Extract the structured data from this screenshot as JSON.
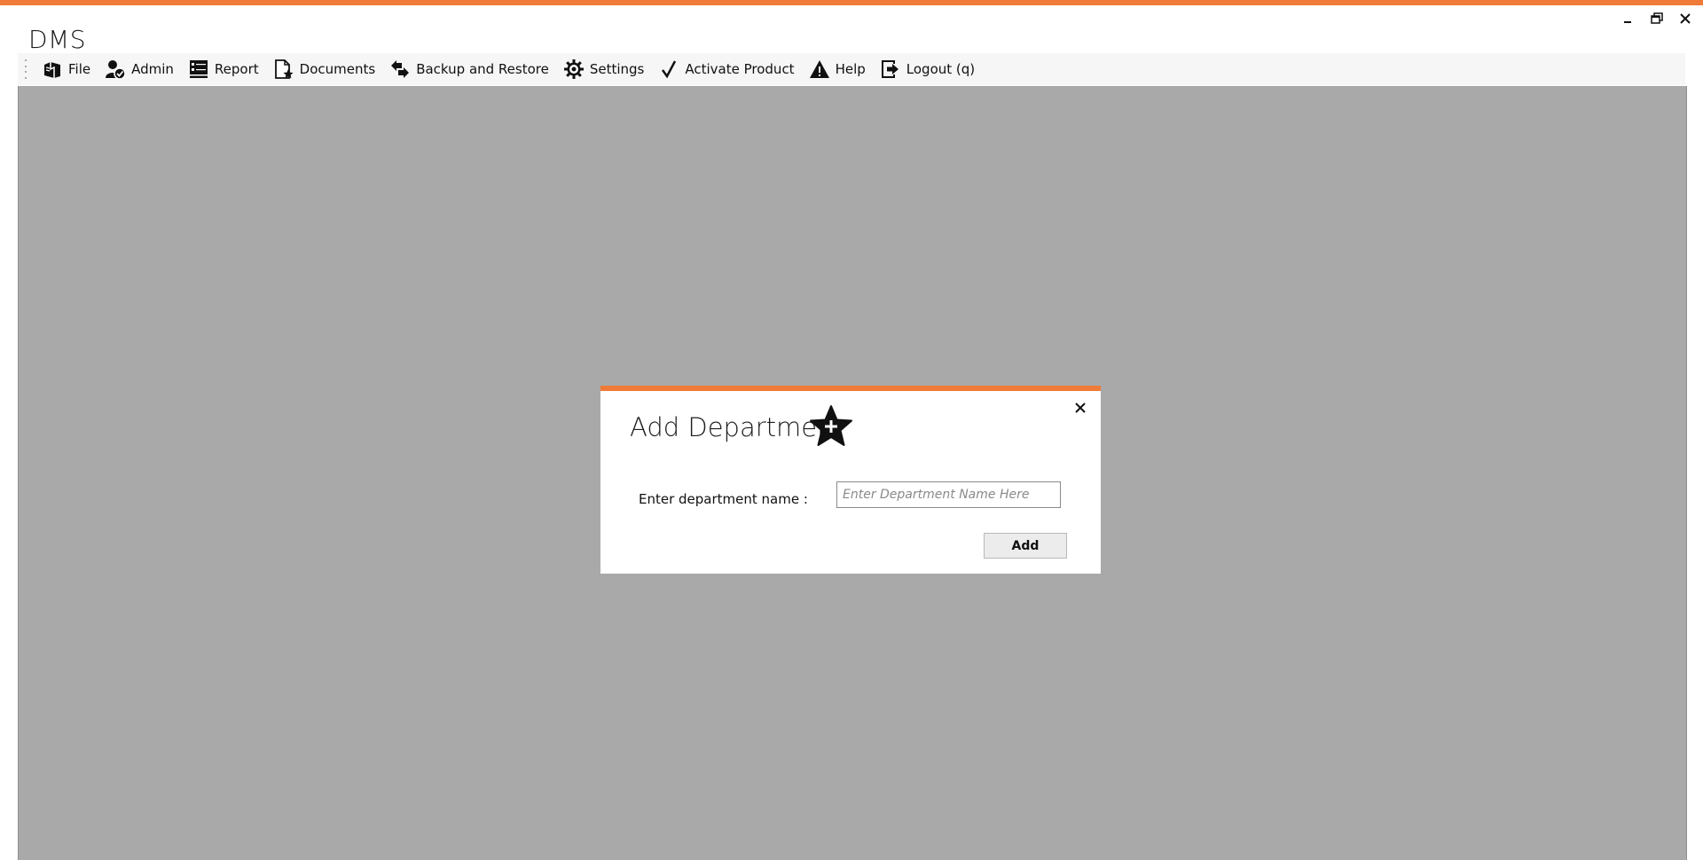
{
  "app": {
    "title": "DMS",
    "accent_color": "#f07a37",
    "workspace_color": "#a9a9a9"
  },
  "window_controls": [
    {
      "name": "minimize",
      "icon": "minimize-icon"
    },
    {
      "name": "restore",
      "icon": "restore-icon"
    },
    {
      "name": "close",
      "icon": "close-icon"
    }
  ],
  "menu": {
    "items": [
      {
        "id": "file",
        "label": "File",
        "icon": "file-icon"
      },
      {
        "id": "admin",
        "label": "Admin",
        "icon": "admin-user-icon"
      },
      {
        "id": "report",
        "label": "Report",
        "icon": "report-icon"
      },
      {
        "id": "documents",
        "label": "Documents",
        "icon": "document-star-icon"
      },
      {
        "id": "backup",
        "label": "Backup and Restore",
        "icon": "backup-restore-icon"
      },
      {
        "id": "settings",
        "label": "Settings",
        "icon": "gear-icon"
      },
      {
        "id": "activate",
        "label": "Activate Product",
        "icon": "check-icon"
      },
      {
        "id": "help",
        "label": "Help",
        "icon": "warning-icon"
      },
      {
        "id": "logout",
        "label": "Logout (q)",
        "icon": "logout-icon"
      }
    ]
  },
  "dialog": {
    "title": "Add Departmen",
    "title_icon": "star-plus-icon",
    "field_label": "Enter department name :",
    "input_value": "",
    "input_placeholder": "Enter Department Name Here",
    "add_label": "Add",
    "close_icon": "close-icon"
  }
}
